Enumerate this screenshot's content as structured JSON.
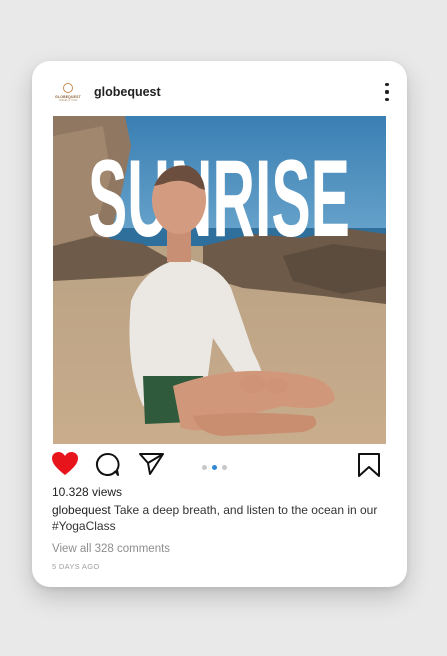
{
  "post": {
    "username": "globequest",
    "avatar": {
      "brand": "GLOBEQUEST",
      "tagline": "TRAVEL & YOGA"
    },
    "image_text": "SUNRISE",
    "views": "10.328 views",
    "caption_user": "globequest",
    "caption_text": " Take a deep breath, and listen to the ocean in our #YogaClass",
    "comments_link": "View all 328 comments",
    "time_ago": "5 DAYS AGO",
    "carousel": {
      "total": 3,
      "active_index": 1
    }
  },
  "icons": {
    "more": "more-vertical-icon",
    "like": "heart-icon",
    "comment": "comment-icon",
    "share": "send-icon",
    "save": "bookmark-icon"
  },
  "colors": {
    "like_active": "#e8141c",
    "carousel_active": "#2f88d8",
    "sky": "#3e86b8"
  }
}
